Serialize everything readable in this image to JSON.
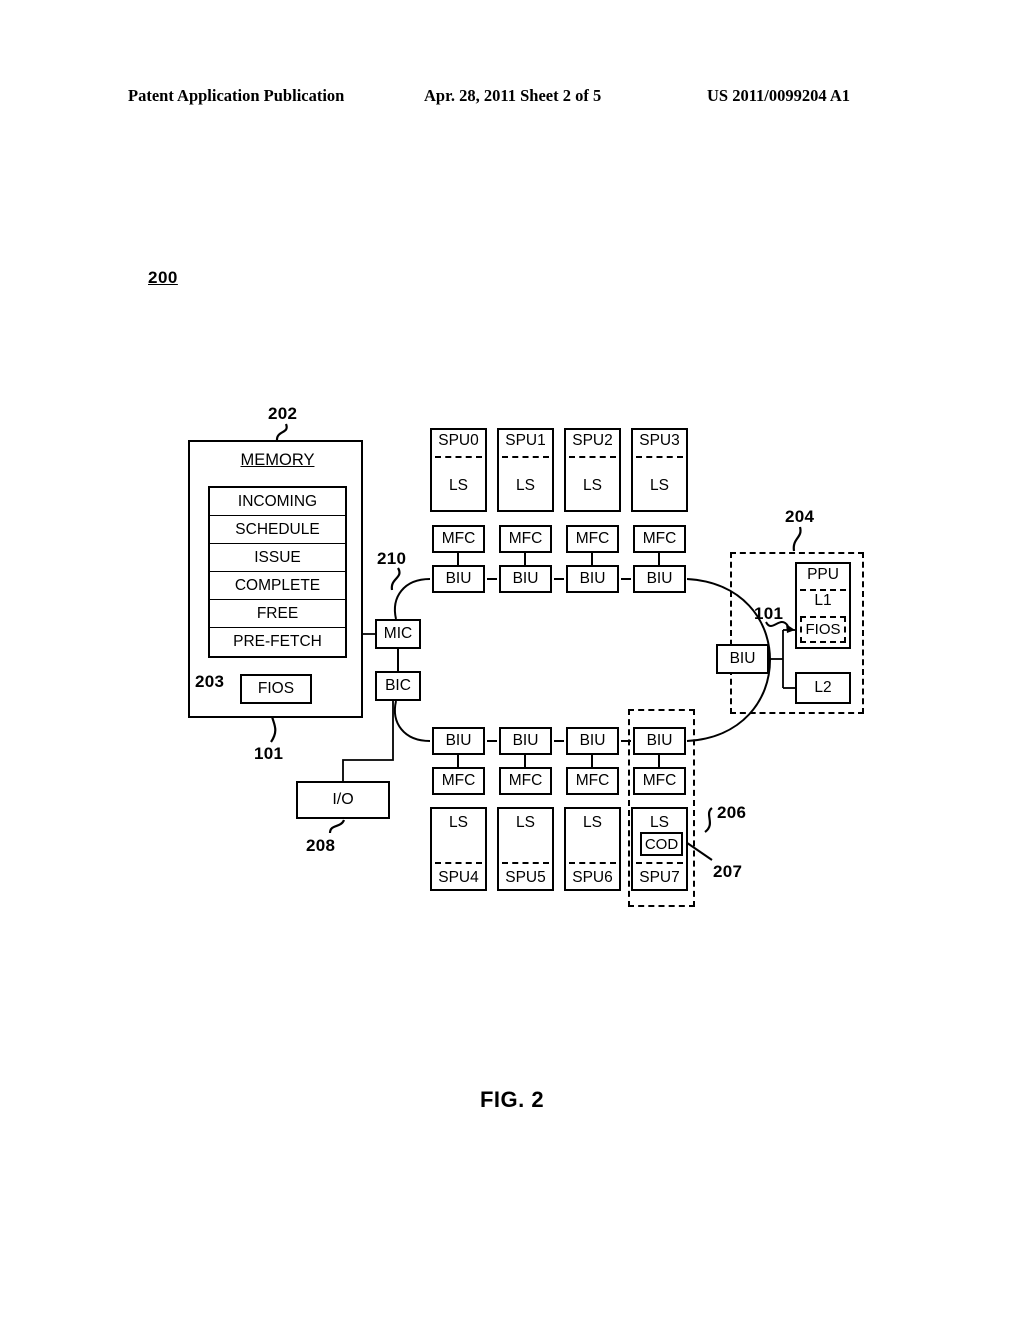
{
  "header": {
    "left": "Patent Application Publication",
    "middle": "Apr. 28, 2011  Sheet 2 of 5",
    "right": "US 2011/0099204 A1"
  },
  "figure": {
    "number_label": "200",
    "caption": "FIG. 2"
  },
  "memory": {
    "title": "MEMORY",
    "queues": [
      "INCOMING",
      "SCHEDULE",
      "ISSUE",
      "COMPLETE",
      "FREE",
      "PRE-FETCH"
    ],
    "fios_label": "FIOS"
  },
  "controllers": {
    "mic": "MIC",
    "bic": "BIC",
    "io": "I/O"
  },
  "spus_top": [
    {
      "name": "SPU0",
      "ls": "LS",
      "mfc": "MFC",
      "biu": "BIU"
    },
    {
      "name": "SPU1",
      "ls": "LS",
      "mfc": "MFC",
      "biu": "BIU"
    },
    {
      "name": "SPU2",
      "ls": "LS",
      "mfc": "MFC",
      "biu": "BIU"
    },
    {
      "name": "SPU3",
      "ls": "LS",
      "mfc": "MFC",
      "biu": "BIU"
    }
  ],
  "spus_bottom": [
    {
      "name": "SPU4",
      "ls": "LS",
      "mfc": "MFC",
      "biu": "BIU",
      "cod": null
    },
    {
      "name": "SPU5",
      "ls": "LS",
      "mfc": "MFC",
      "biu": "BIU",
      "cod": null
    },
    {
      "name": "SPU6",
      "ls": "LS",
      "mfc": "MFC",
      "biu": "BIU",
      "cod": null
    },
    {
      "name": "SPU7",
      "ls": "LS",
      "mfc": "MFC",
      "biu": "BIU",
      "cod": "COD"
    }
  ],
  "ppu_cluster": {
    "biu": "BIU",
    "ppu": "PPU",
    "l1": "L1",
    "fios": "FIOS",
    "l2": "L2"
  },
  "reference_numerals": {
    "memory": "202",
    "queues": "203",
    "fios_memory": "101",
    "io": "208",
    "ring_bus": "210",
    "ppu_group": "204",
    "fios_ppu": "101",
    "spu7_group": "206",
    "cod": "207"
  },
  "colors": {
    "ink": "#000000",
    "paper": "#ffffff"
  }
}
